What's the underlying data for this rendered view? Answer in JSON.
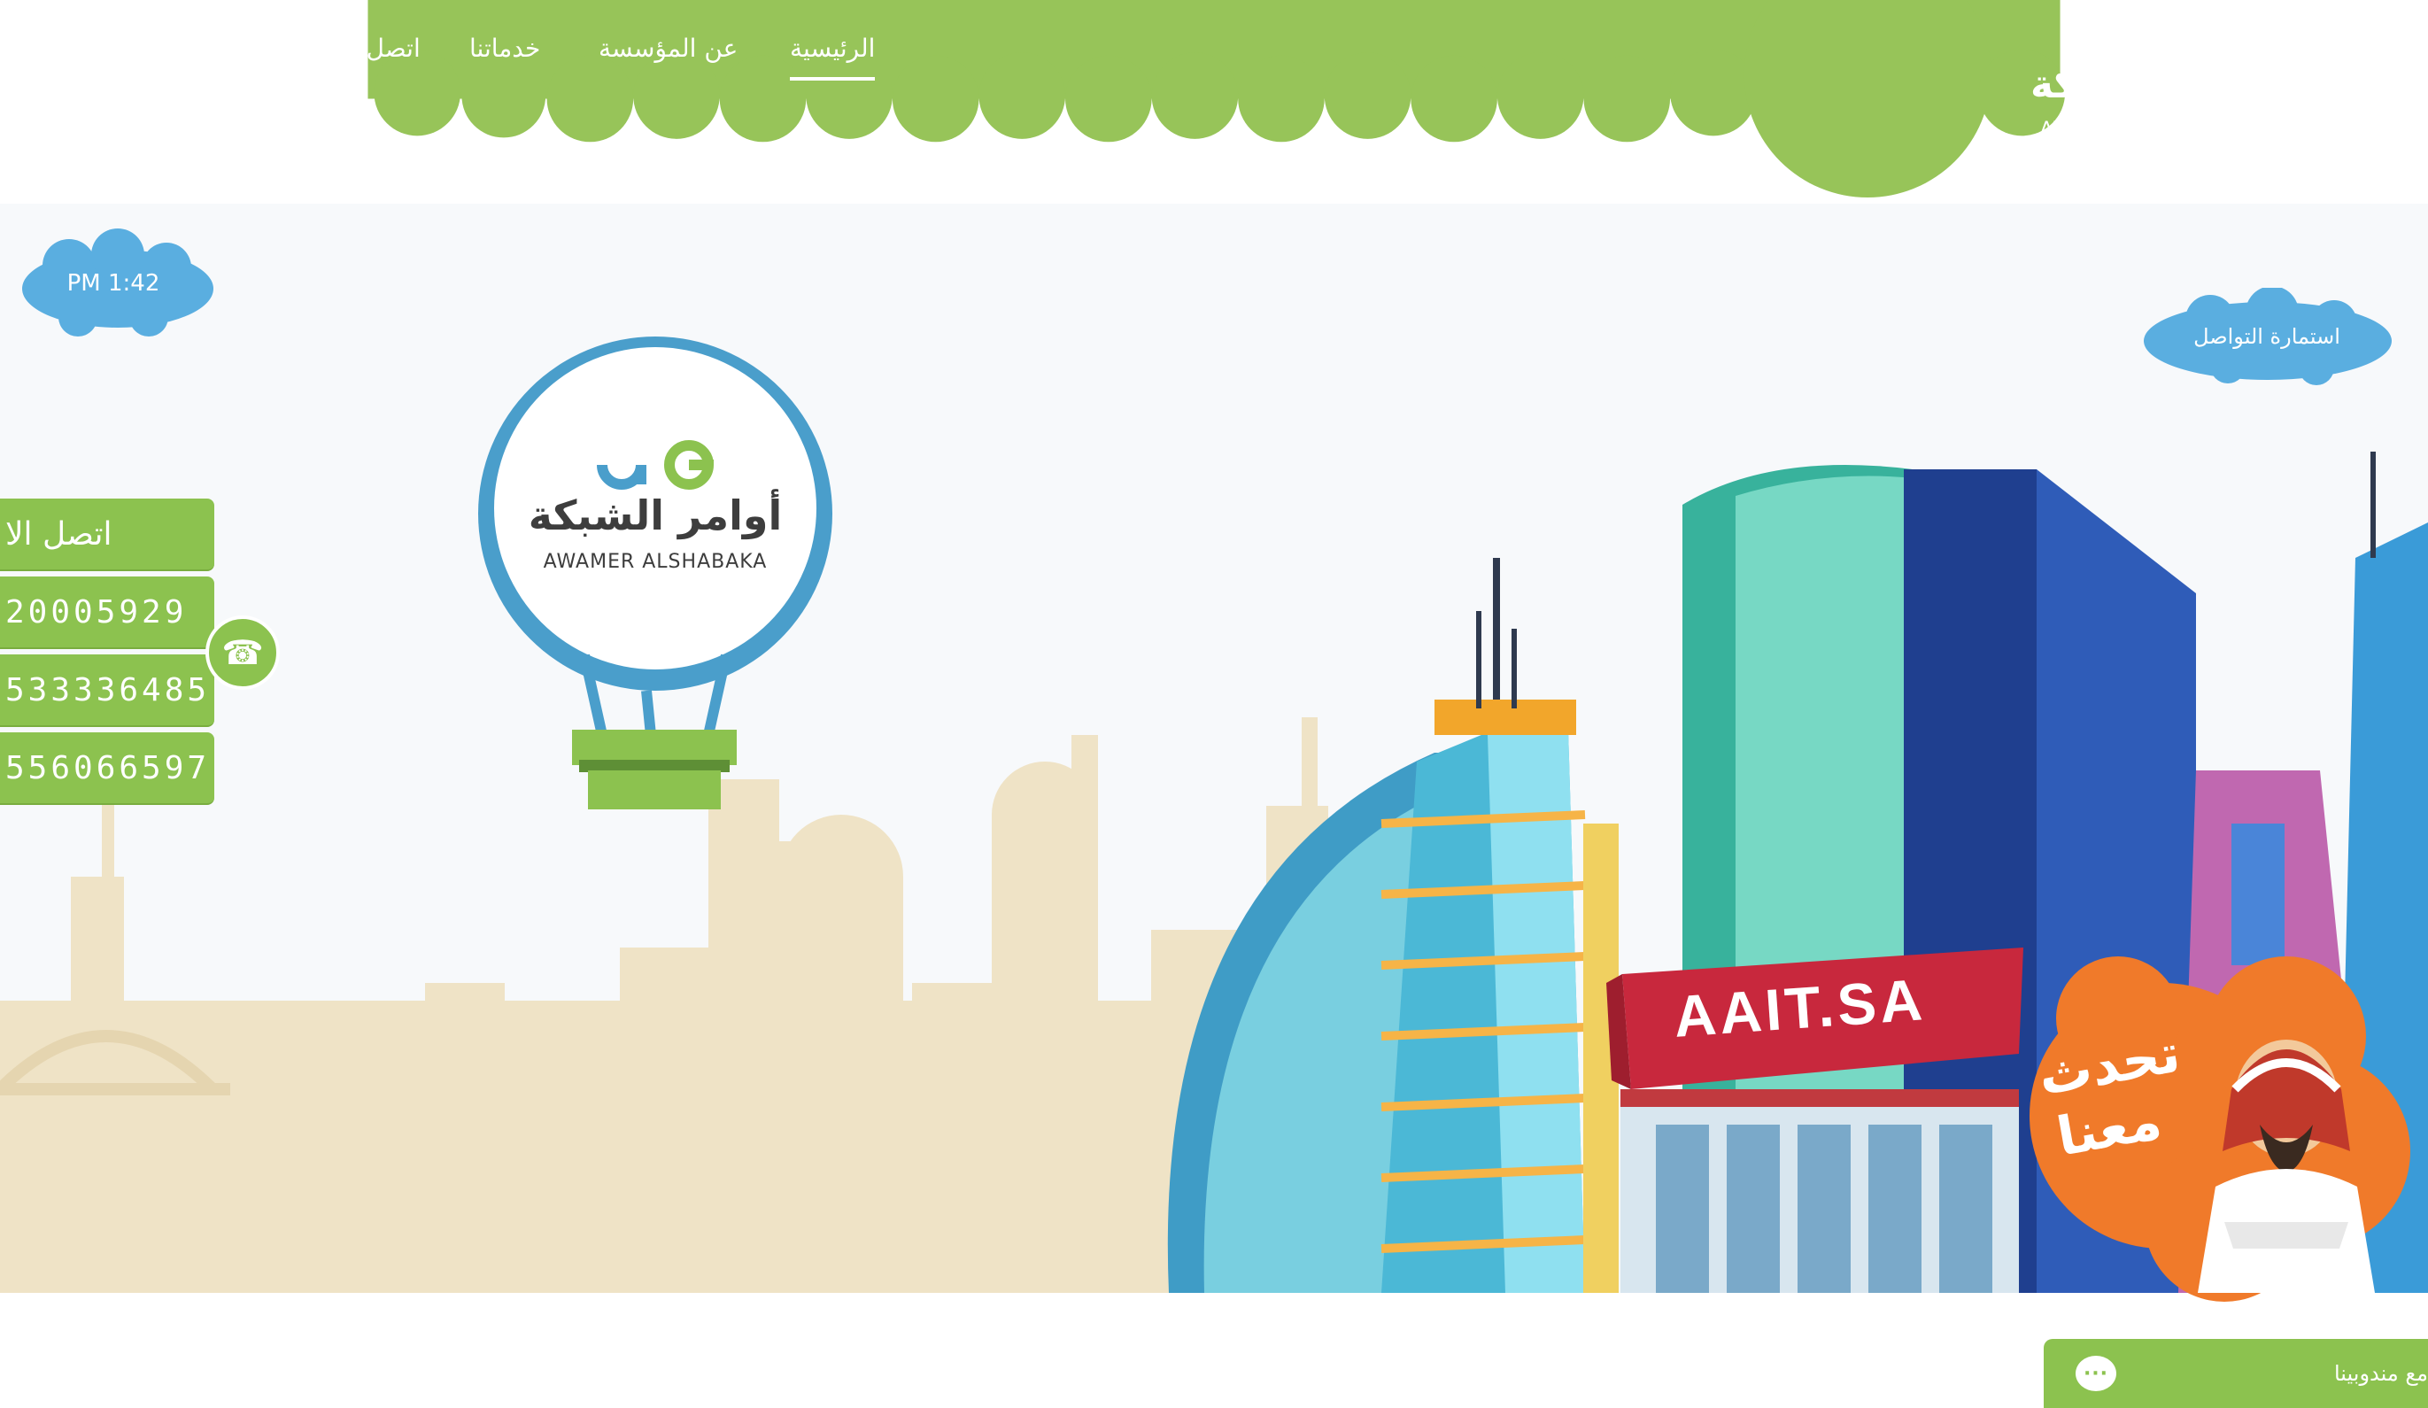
{
  "nav": {
    "home": "الرئيسية",
    "about": "عن المؤسسة",
    "services": "خدماتنا",
    "contact": "اتصل بنا",
    "search_icon": "search-icon"
  },
  "logo": {
    "arabic": "أوامر الشبكة",
    "latin": "AWAMER ALSHABAKA"
  },
  "clock": {
    "time": "PM 1:42"
  },
  "contact_form": {
    "label": "استمارة التواصل"
  },
  "phone_panel": {
    "title": "اتصل الا",
    "numbers": [
      "20005929",
      "533336485",
      "556066597"
    ],
    "icon": "telephone-icon"
  },
  "balloon": {
    "arabic": "أوامر الشبكة",
    "latin": "AWAMER ALSHABAKA"
  },
  "banner": {
    "sign": "AAIT.SA",
    "talk_line1": "تحدث",
    "talk_line2": "معنا"
  },
  "chat": {
    "label": "مع مندوبينا"
  },
  "colors": {
    "green": "#8cc24f",
    "green_dark": "#79ad3f",
    "sky_cloud": "#5aaee0",
    "balloon_blue": "#4a9ecb",
    "orange": "#f07a2a"
  }
}
